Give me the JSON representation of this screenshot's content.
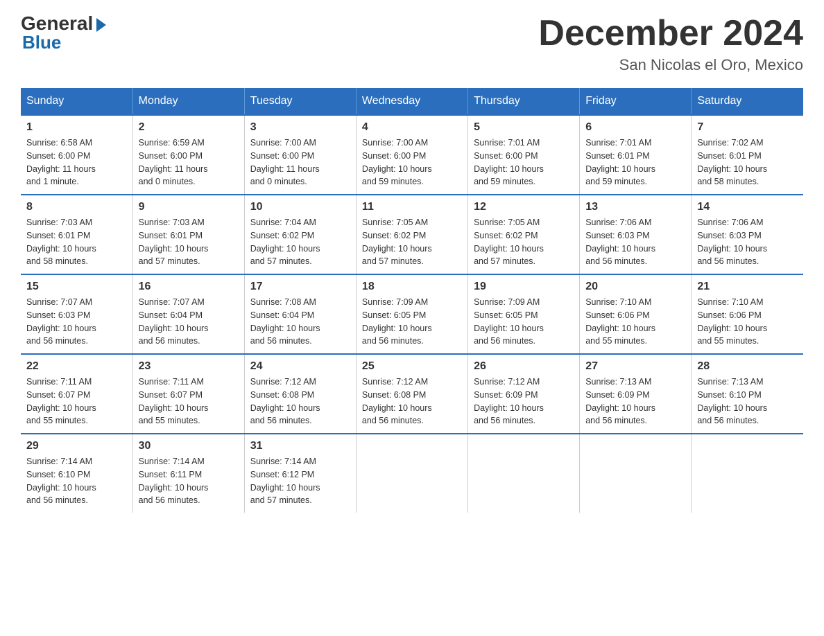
{
  "header": {
    "logo_line1": "General",
    "logo_line2": "Blue",
    "month_title": "December 2024",
    "location": "San Nicolas el Oro, Mexico"
  },
  "days_of_week": [
    "Sunday",
    "Monday",
    "Tuesday",
    "Wednesday",
    "Thursday",
    "Friday",
    "Saturday"
  ],
  "weeks": [
    [
      {
        "day": "1",
        "sunrise": "6:58 AM",
        "sunset": "6:00 PM",
        "daylight": "11 hours and 1 minute."
      },
      {
        "day": "2",
        "sunrise": "6:59 AM",
        "sunset": "6:00 PM",
        "daylight": "11 hours and 0 minutes."
      },
      {
        "day": "3",
        "sunrise": "7:00 AM",
        "sunset": "6:00 PM",
        "daylight": "11 hours and 0 minutes."
      },
      {
        "day": "4",
        "sunrise": "7:00 AM",
        "sunset": "6:00 PM",
        "daylight": "10 hours and 59 minutes."
      },
      {
        "day": "5",
        "sunrise": "7:01 AM",
        "sunset": "6:00 PM",
        "daylight": "10 hours and 59 minutes."
      },
      {
        "day": "6",
        "sunrise": "7:01 AM",
        "sunset": "6:01 PM",
        "daylight": "10 hours and 59 minutes."
      },
      {
        "day": "7",
        "sunrise": "7:02 AM",
        "sunset": "6:01 PM",
        "daylight": "10 hours and 58 minutes."
      }
    ],
    [
      {
        "day": "8",
        "sunrise": "7:03 AM",
        "sunset": "6:01 PM",
        "daylight": "10 hours and 58 minutes."
      },
      {
        "day": "9",
        "sunrise": "7:03 AM",
        "sunset": "6:01 PM",
        "daylight": "10 hours and 57 minutes."
      },
      {
        "day": "10",
        "sunrise": "7:04 AM",
        "sunset": "6:02 PM",
        "daylight": "10 hours and 57 minutes."
      },
      {
        "day": "11",
        "sunrise": "7:05 AM",
        "sunset": "6:02 PM",
        "daylight": "10 hours and 57 minutes."
      },
      {
        "day": "12",
        "sunrise": "7:05 AM",
        "sunset": "6:02 PM",
        "daylight": "10 hours and 57 minutes."
      },
      {
        "day": "13",
        "sunrise": "7:06 AM",
        "sunset": "6:03 PM",
        "daylight": "10 hours and 56 minutes."
      },
      {
        "day": "14",
        "sunrise": "7:06 AM",
        "sunset": "6:03 PM",
        "daylight": "10 hours and 56 minutes."
      }
    ],
    [
      {
        "day": "15",
        "sunrise": "7:07 AM",
        "sunset": "6:03 PM",
        "daylight": "10 hours and 56 minutes."
      },
      {
        "day": "16",
        "sunrise": "7:07 AM",
        "sunset": "6:04 PM",
        "daylight": "10 hours and 56 minutes."
      },
      {
        "day": "17",
        "sunrise": "7:08 AM",
        "sunset": "6:04 PM",
        "daylight": "10 hours and 56 minutes."
      },
      {
        "day": "18",
        "sunrise": "7:09 AM",
        "sunset": "6:05 PM",
        "daylight": "10 hours and 56 minutes."
      },
      {
        "day": "19",
        "sunrise": "7:09 AM",
        "sunset": "6:05 PM",
        "daylight": "10 hours and 56 minutes."
      },
      {
        "day": "20",
        "sunrise": "7:10 AM",
        "sunset": "6:06 PM",
        "daylight": "10 hours and 55 minutes."
      },
      {
        "day": "21",
        "sunrise": "7:10 AM",
        "sunset": "6:06 PM",
        "daylight": "10 hours and 55 minutes."
      }
    ],
    [
      {
        "day": "22",
        "sunrise": "7:11 AM",
        "sunset": "6:07 PM",
        "daylight": "10 hours and 55 minutes."
      },
      {
        "day": "23",
        "sunrise": "7:11 AM",
        "sunset": "6:07 PM",
        "daylight": "10 hours and 55 minutes."
      },
      {
        "day": "24",
        "sunrise": "7:12 AM",
        "sunset": "6:08 PM",
        "daylight": "10 hours and 56 minutes."
      },
      {
        "day": "25",
        "sunrise": "7:12 AM",
        "sunset": "6:08 PM",
        "daylight": "10 hours and 56 minutes."
      },
      {
        "day": "26",
        "sunrise": "7:12 AM",
        "sunset": "6:09 PM",
        "daylight": "10 hours and 56 minutes."
      },
      {
        "day": "27",
        "sunrise": "7:13 AM",
        "sunset": "6:09 PM",
        "daylight": "10 hours and 56 minutes."
      },
      {
        "day": "28",
        "sunrise": "7:13 AM",
        "sunset": "6:10 PM",
        "daylight": "10 hours and 56 minutes."
      }
    ],
    [
      {
        "day": "29",
        "sunrise": "7:14 AM",
        "sunset": "6:10 PM",
        "daylight": "10 hours and 56 minutes."
      },
      {
        "day": "30",
        "sunrise": "7:14 AM",
        "sunset": "6:11 PM",
        "daylight": "10 hours and 56 minutes."
      },
      {
        "day": "31",
        "sunrise": "7:14 AM",
        "sunset": "6:12 PM",
        "daylight": "10 hours and 57 minutes."
      },
      null,
      null,
      null,
      null
    ]
  ],
  "labels": {
    "sunrise": "Sunrise:",
    "sunset": "Sunset:",
    "daylight": "Daylight:"
  }
}
